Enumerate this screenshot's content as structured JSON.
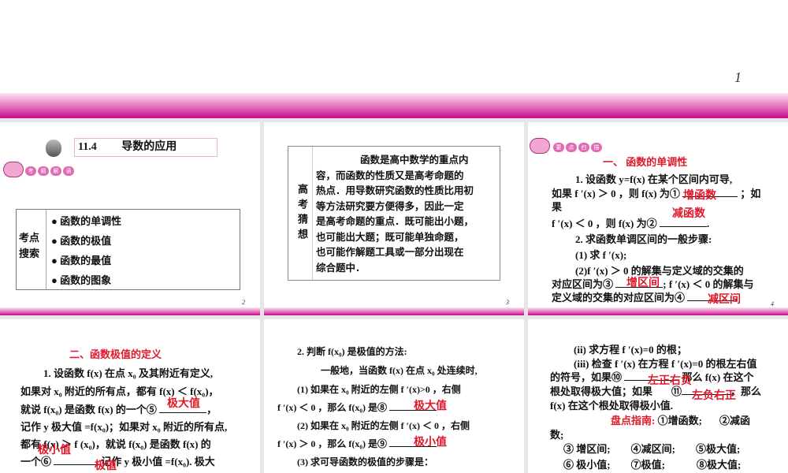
{
  "slide1": {
    "number": "1"
  },
  "slide2": {
    "number": "2",
    "section_no": "11.4",
    "title": "导数的应用",
    "badge": [
      "考",
      "纲",
      "解",
      "读"
    ],
    "label": "考点搜索",
    "items": [
      "函数的单调性",
      "函数的极值",
      "函数的最值",
      "函数的图象"
    ]
  },
  "slide3": {
    "number": "3",
    "label": "高考猜想",
    "lines": [
      "函数是高中数学的重点内",
      "容，而函数的性质又是高考命题的",
      "热点．用导数研究函数的性质比用初",
      "等方法研究要方便得多，因此一定",
      "是高考命题的重点．既可能出小题，",
      "也可能出大题；既可能单独命题，",
      "也可能作解题工具或一部分出现在",
      "综合题中．"
    ]
  },
  "slide4": {
    "number": "4",
    "badge": [
      "要",
      "点",
      "扫",
      "描"
    ],
    "heading": "一、 函数的单调性",
    "lines": [
      "1. 设函数 y=f(x) 在某个区间内可导,",
      "如果 f ′(x) ＞ 0 ，则 f(x) 为①",
      "；如",
      "果",
      "f ′(x) ＜ 0 ，则 f(x) 为②",
      ".",
      "2. 求函数单调区间的一般步骤:",
      "(1) 求 f ′(x);",
      "(2)f ′(x) ＞ 0 的解集与定义域的交集的",
      "对应区间为③",
      "; f ′(x) ＜ 0 的解集与",
      "定义域的交集的对应区间为④",
      "."
    ],
    "answers": [
      "增函数",
      "减函数",
      "增区间",
      "减区间"
    ]
  },
  "slide5": {
    "heading": "二、函数极值的定义",
    "lines": [
      "1. 设函数 f(x) 在点 x₀ 及其附近有定义,",
      "如果对 x₀ 附近的所有点，都有 f(x) ＜ f(x₀)，",
      "就说 f(x₀) 是函数 f(x) 的一个⑤",
      "，",
      "记作 y 极大值 =f(x₀)；如果对 x₀ 附近的所有点,",
      "都有 f(x) ＞ f (x₀)，就说 f(x₀) 是函数 f(x) 的",
      "一个⑥",
      "记作 y 极小值 =f(x₀). 极大"
    ],
    "answers": [
      "极大值",
      "极小值",
      "极值"
    ]
  },
  "slide6": {
    "lines": [
      "2. 判断 f(x₀) 是极值的方法:",
      "一般地，当函数 f(x) 在点 x₀ 处连续时,",
      "(1) 如果在 x₀ 附近的左侧 f ′(x)>0 ，右侧",
      "f ′(x) ＜ 0 ，那么 f(x₀) 是⑧",
      "(2) 如果在 x₀ 附近的左侧 f ′(x) ＜ 0 ，右侧",
      "f ′(x) ＞ 0 ，那么 f(x₀) 是⑨",
      "(3) 求可导函数的极值的步骤是："
    ],
    "answers": [
      "极大值",
      "极小值"
    ]
  },
  "slide7": {
    "lines": [
      "(ii) 求方程 f ′(x)=0 的根；",
      "(iii) 检查 f ′(x) 在方程 f ′(x)=0 的根左右值",
      "的符号，如果⑩",
      "那么 f(x) 在这个",
      "根处取得极大值；如果",
      "⑪",
      "，那么",
      "f(x) 在这个根处取得极小值."
    ],
    "answers": [
      "左正右负",
      "左负右正"
    ],
    "guide_label": "盘点指南:",
    "guide": [
      "①增函数;",
      "②减函",
      "数;",
      "③ 增区间;",
      "④减区间;",
      "⑤极大值;",
      "⑥ 极小值;",
      "⑦极值;",
      "⑧极大值;"
    ]
  },
  "colors": {
    "accent": "#c4088f",
    "answer": "#e0182a"
  }
}
